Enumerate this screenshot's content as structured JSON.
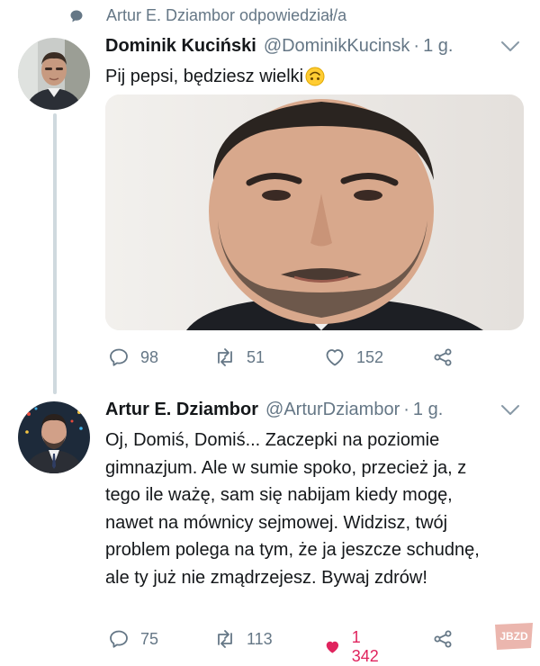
{
  "context": {
    "text": "Artur E. Dziambor odpowiedział/a",
    "icon": "comment-bubble-icon"
  },
  "tweets": [
    {
      "name": "Dominik Kuciński",
      "handle": "@DominikKucinsk",
      "time": "1 g.",
      "text": "Pij pepsi, będziesz wielki",
      "emoji": "upside-down-face-emoji",
      "counts": {
        "replies": "98",
        "retweets": "51",
        "likes": "152"
      }
    },
    {
      "name": "Artur E. Dziambor",
      "handle": "@ArturDziambor",
      "time": "1 g.",
      "text": "Oj, Domiś, Domiś... Zaczepki na poziomie gimnazjum. Ale w sumie spoko, przecież ja, z tego ile ważę, sam się nabijam kiedy mogę, nawet na mównicy sejmowej. Widzisz, twój problem polega na tym, że ja jeszcze schudnę, ale ty już nie zmądrzejesz. Bywaj zdrów!",
      "counts": {
        "replies": "75",
        "retweets": "113",
        "likes": "1 342"
      },
      "liked": true
    }
  ],
  "watermark": {
    "text": "JBZD"
  },
  "colors": {
    "secondary": "#657786",
    "like": "#e0245e",
    "text": "#14171a"
  }
}
